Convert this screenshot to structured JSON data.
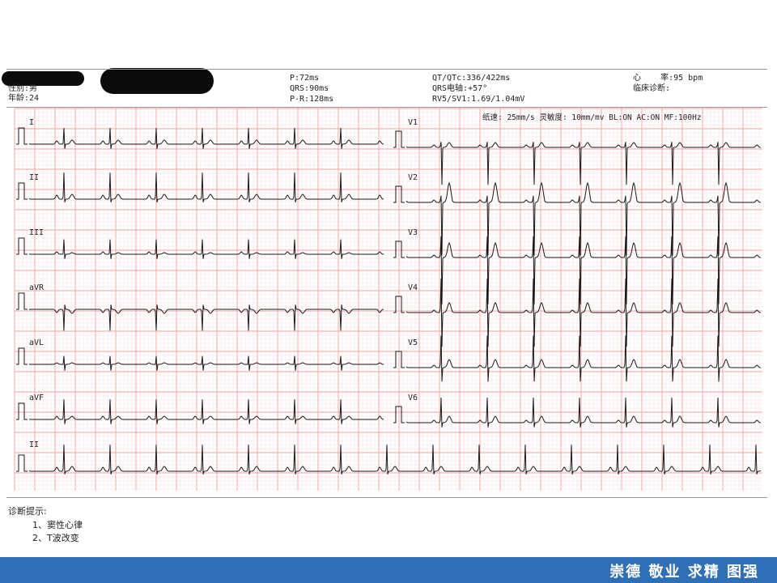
{
  "patient": {
    "gender": "性别:男",
    "age": "年龄:24"
  },
  "measurements": {
    "p": "P:72ms",
    "qrs": "QRS:90ms",
    "pr": "P-R:128ms",
    "qt": "QT/QTc:336/422ms",
    "axis": "QRS电轴:+57°",
    "rv5sv1": "RV5/SV1:1.69/1.04mV",
    "heart_rate": "心    率:95 bpm",
    "clinical": "临床诊断:"
  },
  "settings": "纸速: 25mm/s  灵敏度: 10mm/mv BL:ON  AC:ON  MF:100Hz",
  "chart_data": {
    "type": "ecg",
    "paper_speed": "25mm/s",
    "sensitivity": "10mm/mv",
    "heart_rate_bpm": 95,
    "leads_left": [
      "I",
      "II",
      "III",
      "aVR",
      "aVL",
      "aVF"
    ],
    "leads_right": [
      "V1",
      "V2",
      "V3",
      "V4",
      "V5",
      "V6"
    ],
    "rhythm_lead": "II",
    "grid_color": "#f0a0a0",
    "trace_color": "#1a1a1a"
  },
  "diagnosis": {
    "title": "诊断提示:",
    "items": [
      "1、窦性心律",
      "2、T波改变"
    ]
  },
  "footer": {
    "motto": "崇德  敬业  求精  图强",
    "color": "#2f6fb6"
  }
}
